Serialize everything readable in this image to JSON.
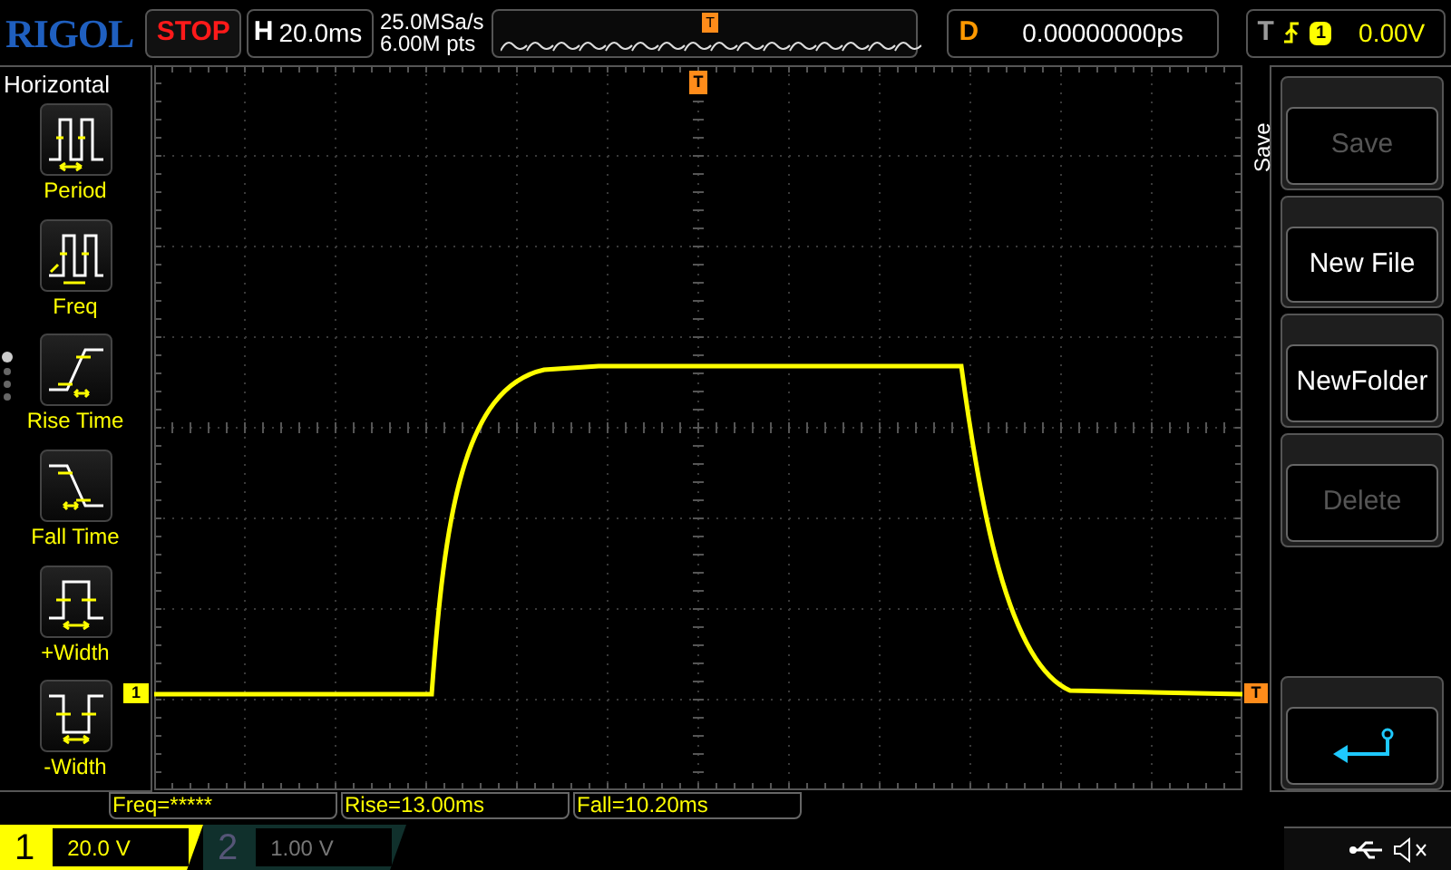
{
  "top_bar": {
    "logo": "RIGOL",
    "run_state": "STOP",
    "timebase_label": "H",
    "timebase": "20.0ms",
    "sample_rate": "25.0MSa/s",
    "memory_depth": "6.00M pts",
    "delay_label": "D",
    "delay": "0.00000000ps",
    "trigger_label": "T",
    "trigger_source": "1",
    "trigger_level": "0.00V",
    "overview_marker": "T"
  },
  "left_menu": {
    "title": "Horizontal",
    "items": [
      {
        "kind": "period",
        "label": "Period"
      },
      {
        "kind": "freq",
        "label": "Freq"
      },
      {
        "kind": "rise",
        "label": "Rise Time"
      },
      {
        "kind": "fall",
        "label": "Fall Time"
      },
      {
        "kind": "pwidth",
        "label": "+Width"
      },
      {
        "kind": "nwidth",
        "label": "-Width"
      }
    ],
    "pages": [
      {
        "selected": true
      },
      {
        "selected": false
      },
      {
        "selected": false
      },
      {
        "selected": false
      }
    ]
  },
  "plot": {
    "channel_marker": "1",
    "trigger_marker_top": "T",
    "trigger_marker_right": "T"
  },
  "right_menu": {
    "title": "Save",
    "buttons": [
      {
        "kind": "text",
        "label": "Save",
        "disabled": true
      },
      {
        "kind": "text",
        "label": "New File",
        "disabled": false
      },
      {
        "kind": "text",
        "label": "NewFolder",
        "disabled": false
      },
      {
        "kind": "text",
        "label": "Delete",
        "disabled": true
      },
      {
        "kind": "back"
      }
    ]
  },
  "measurements": [
    "Freq=*****",
    "Rise=13.00ms",
    "Fall=10.20ms"
  ],
  "channels": [
    {
      "number": "1",
      "scale": "20.0 V",
      "active": true
    },
    {
      "number": "2",
      "scale": "1.00 V",
      "active": false
    }
  ]
}
